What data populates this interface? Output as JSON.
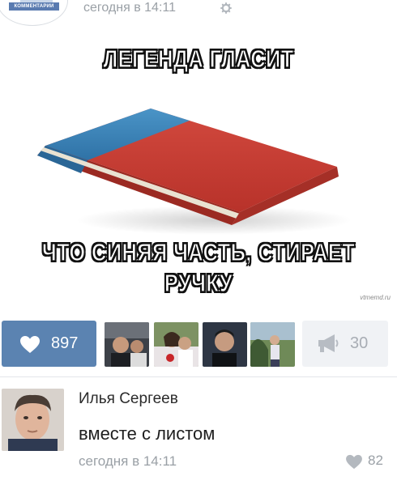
{
  "post": {
    "group_logo_text": "КОММЕНТАРИИ",
    "time": "сегодня в 14:11",
    "settings_icon": "gear-icon",
    "meme": {
      "top_text": "ЛЕГЕНДА ГЛАСИТ",
      "bottom_text_line1": "ЧТО СИНЯЯ ЧАСТЬ, СТИРАЕТ",
      "bottom_text_line2": "РУЧКУ",
      "watermark": "vtmemd.ru",
      "eraser_colors": {
        "blue": "#3d86bb",
        "red": "#c93d34"
      }
    }
  },
  "actions": {
    "like_icon": "heart-icon",
    "like_count": "897",
    "repost_icon": "megaphone-icon",
    "repost_count": "30",
    "accent_color": "#5b83b1",
    "likers": [
      "liker-1",
      "liker-2",
      "liker-3",
      "liker-4"
    ]
  },
  "comment": {
    "author": "Илья Сергеев",
    "text": "вместе с листом",
    "time": "сегодня в 14:11",
    "like_icon": "heart-icon",
    "like_count": "82"
  }
}
